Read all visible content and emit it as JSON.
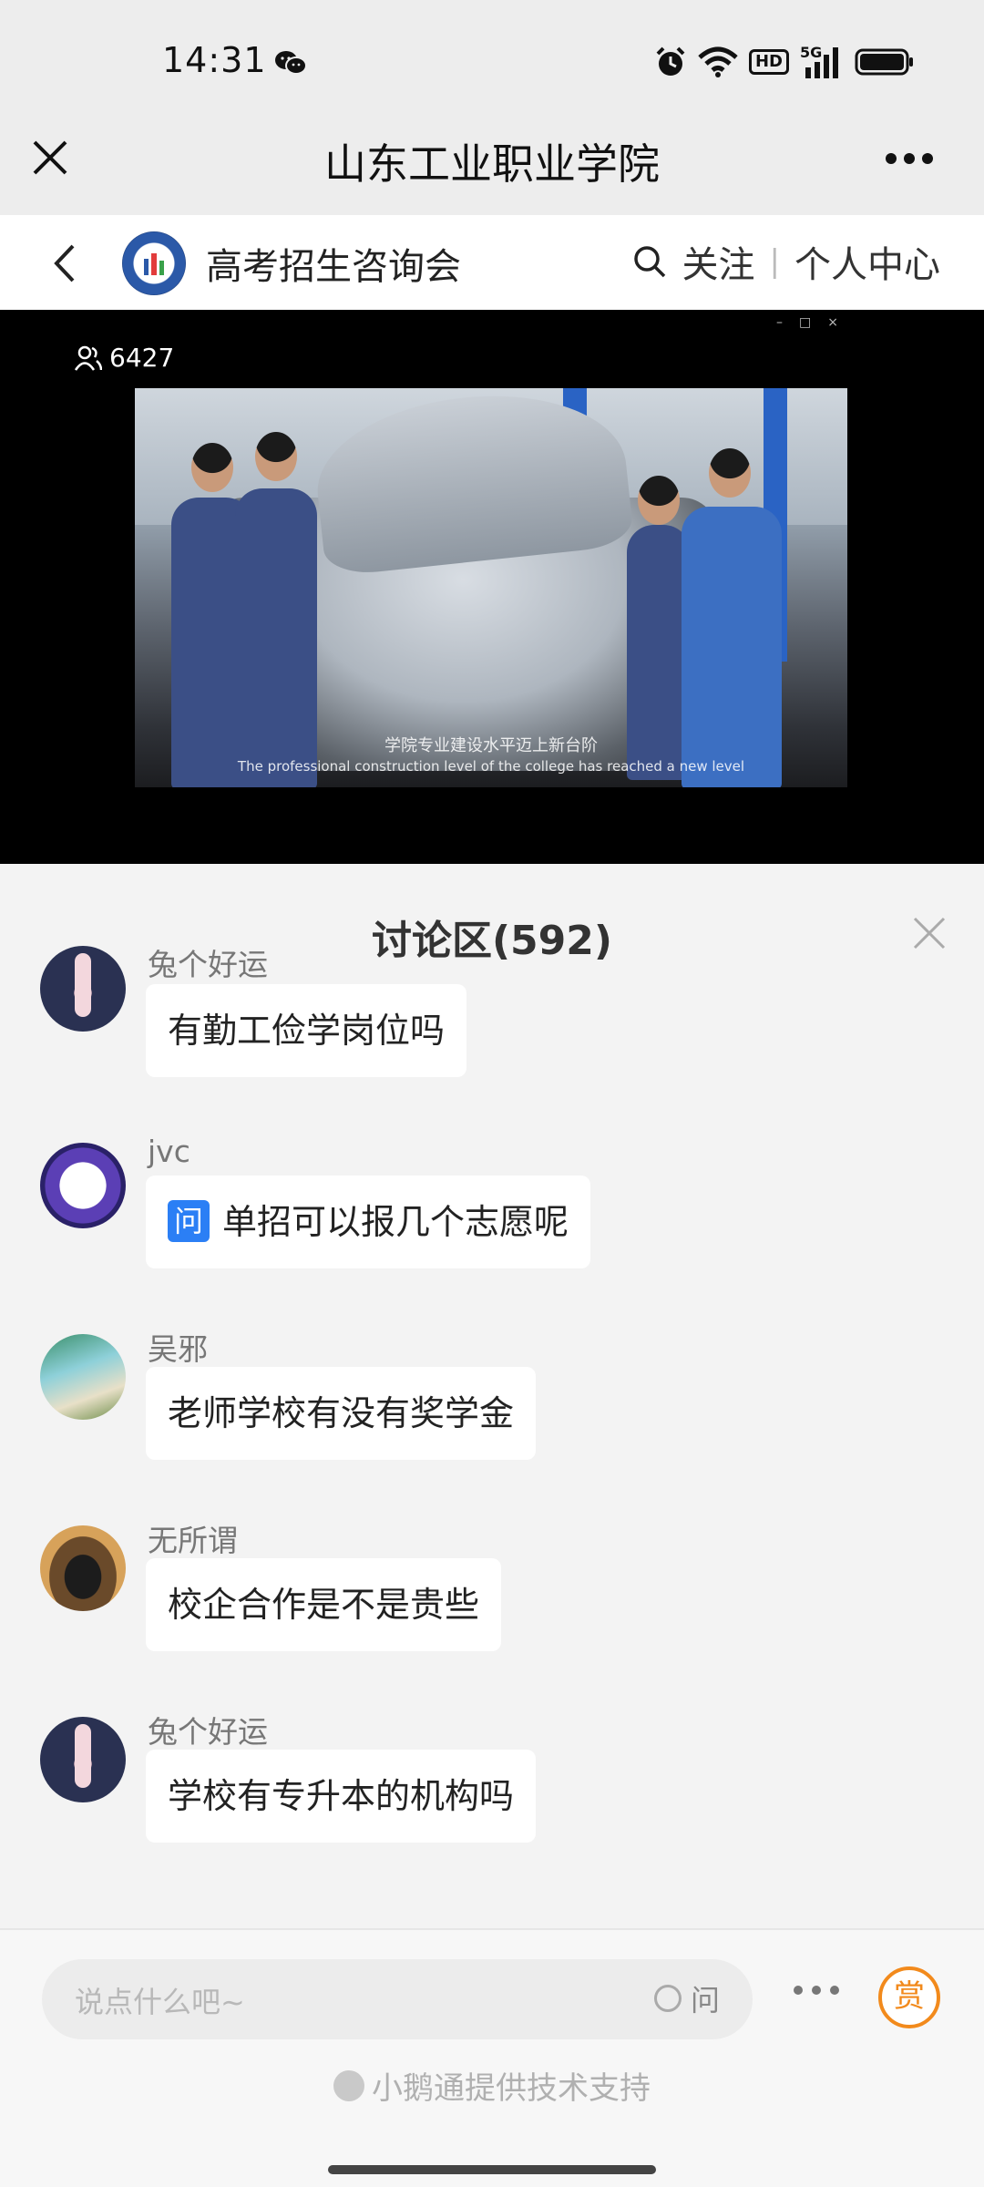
{
  "status_bar": {
    "time": "14:31",
    "hd": "HD",
    "network": "5G"
  },
  "title_bar": {
    "title": "山东工业职业学院"
  },
  "channel": {
    "name": "高考招生咨询会",
    "follow_label": "关注",
    "separator": "|",
    "profile_label": "个人中心"
  },
  "video": {
    "viewer_count": "6427",
    "caption_cn": "学院专业建设水平迈上新台阶",
    "caption_en": "The professional construction level of the college has reached a new level"
  },
  "discussion": {
    "title": "讨论区(592)",
    "messages": [
      {
        "user": "兔个好运",
        "text": "有勤工俭学岗位吗",
        "question": false
      },
      {
        "user": "jvc",
        "text": "单招可以报几个志愿呢",
        "question": true,
        "badge": "问"
      },
      {
        "user": "吴邪",
        "text": "老师学校有没有奖学金",
        "question": false
      },
      {
        "user": "无所谓",
        "text": "校企合作是不是贵些",
        "question": false
      },
      {
        "user": "兔个好运",
        "text": "学校有专升本的机构吗",
        "question": false
      }
    ]
  },
  "input_bar": {
    "placeholder": "说点什么吧~",
    "ask_label": "问",
    "reward_label": "赏",
    "powered_by": "小鹅通提供技术支持"
  },
  "colors": {
    "accent_blue": "#2b7ff5",
    "reward_orange": "#f28a1c",
    "background": "#ededed"
  }
}
